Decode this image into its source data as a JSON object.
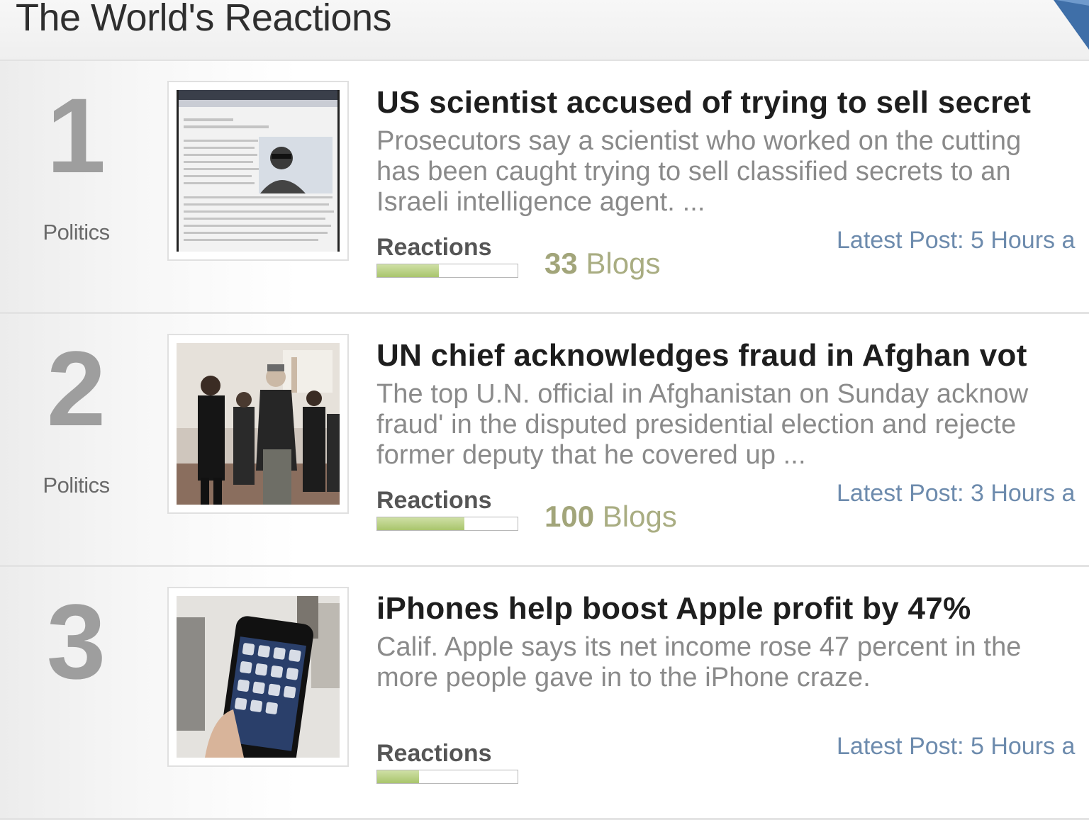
{
  "header": {
    "title": "The World's Reactions",
    "accent_color": "#3f6fa8"
  },
  "colors": {
    "rank": "#9e9e9e",
    "title": "#1e1e1e",
    "summary": "#8a8a8a",
    "blogs": "#a9ad82",
    "latest_link": "#6d8bad",
    "bar_fill": "#a9c56c"
  },
  "stories": [
    {
      "rank": "1",
      "category": "Politics",
      "title": "US scientist accused of trying to sell secret",
      "summary": "Prosecutors say a scientist who worked on the cutting\nhas been caught trying to sell classified secrets to an\nIsraeli intelligence agent. ...",
      "reactions_label": "Reactions",
      "reaction_level": 0.44,
      "blogs_count": "33",
      "blogs_word": " Blogs",
      "latest_post": "Latest Post: 5 Hours a",
      "thumb_icon": "news-article-thumbnail"
    },
    {
      "rank": "2",
      "category": "Politics",
      "title": "UN chief acknowledges fraud in Afghan vot",
      "summary": "The top U.N. official in Afghanistan on Sunday acknow\nfraud' in the disputed presidential election and rejecte\nformer deputy that he covered up ...",
      "reactions_label": "Reactions",
      "reaction_level": 0.62,
      "blogs_count": "100",
      "blogs_word": " Blogs",
      "latest_post": "Latest Post: 3 Hours a",
      "thumb_icon": "officials-walking-photo"
    },
    {
      "rank": "3",
      "category": "",
      "title": "iPhones help boost Apple profit by 47%",
      "summary": "Calif. Apple says its net income rose 47 percent in the\nmore people gave in to the iPhone craze.",
      "reactions_label": "Reactions",
      "reaction_level": 0.3,
      "blogs_count": "",
      "blogs_word": "",
      "latest_post": "Latest Post: 5 Hours a",
      "thumb_icon": "iphone-photo"
    }
  ]
}
